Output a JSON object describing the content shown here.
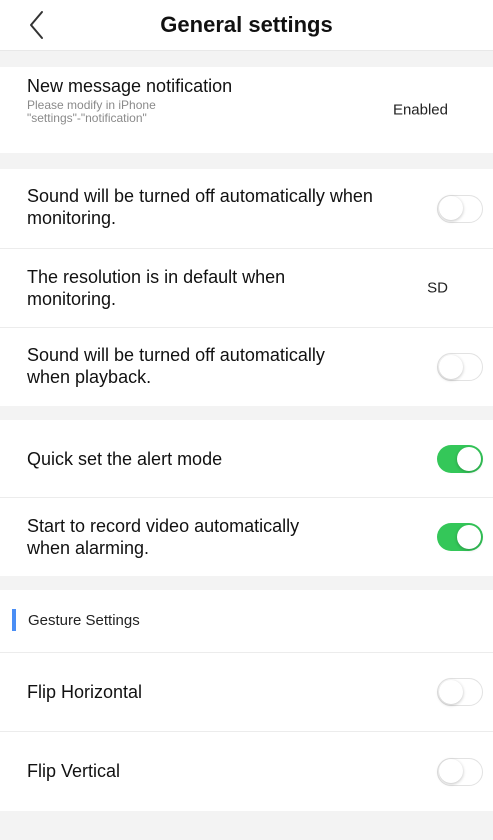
{
  "nav": {
    "title": "General settings",
    "back_icon": "chevron-left-icon"
  },
  "notification": {
    "label": "New message notification",
    "hint_line1": "Please modify in iPhone",
    "hint_line2": "\"settings\"-\"notification\"",
    "value": "Enabled"
  },
  "monitoring": {
    "sound_off_line1": "Sound will be turned off automatically when",
    "sound_off_line2": "monitoring.",
    "sound_off_on": false,
    "resolution_line1": "The resolution is in default when",
    "resolution_line2": "monitoring.",
    "resolution_value": "SD",
    "playback_line1": "Sound will be turned off automatically",
    "playback_line2": "when playback.",
    "playback_on": false
  },
  "alert": {
    "quick_alert_label": "Quick set the alert mode",
    "quick_alert_on": true,
    "record_line1": "Start to record video automatically",
    "record_line2": "when alarming.",
    "record_on": true
  },
  "gesture": {
    "section_title": "Gesture Settings",
    "flip_h_label": "Flip Horizontal",
    "flip_h_on": false,
    "flip_v_label": "Flip Vertical",
    "flip_v_on": false
  },
  "colors": {
    "toggle_on": "#34c759",
    "section_accent": "#4a8ef5",
    "background": "#f3f3f3"
  }
}
